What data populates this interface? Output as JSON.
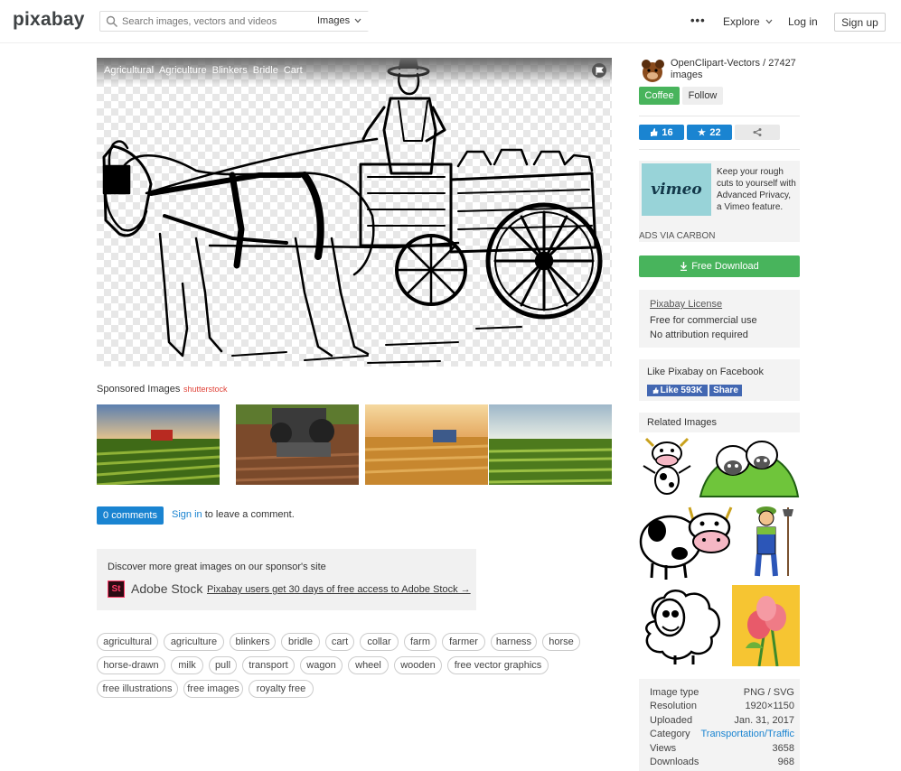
{
  "header": {
    "logo": "pixabay",
    "search_placeholder": "Search images, vectors and videos",
    "search_type": "Images",
    "more": "•••",
    "explore": "Explore",
    "login": "Log in",
    "signup": "Sign up"
  },
  "image": {
    "tags": [
      "Agricultural",
      "Agriculture",
      "Blinkers",
      "Bridle",
      "Cart"
    ]
  },
  "sponsored": {
    "label": "Sponsored Images",
    "provider": "shutterstock"
  },
  "comments": {
    "button": "0 comments",
    "signin": "Sign in",
    "rest": " to leave a comment."
  },
  "adobe": {
    "heading": "Discover more great images on our sponsor's site",
    "logo": "St",
    "brand": "Adobe Stock",
    "link": "Pixabay users get 30 days of free access to Adobe Stock →"
  },
  "tags": [
    "agricultural",
    "agriculture",
    "blinkers",
    "bridle",
    "cart",
    "collar",
    "farm",
    "farmer",
    "harness",
    "horse",
    "horse-drawn",
    "milk",
    "pull",
    "transport",
    "wagon",
    "wheel",
    "wooden",
    "free vector graphics",
    "free illustrations",
    "free images",
    "royalty free"
  ],
  "sidebar": {
    "author": "OpenClipart-Vectors / 27427 images",
    "coffee": "Coffee",
    "follow": "Follow",
    "likes": "16",
    "favorites": "22",
    "ad_text": "Keep your rough cuts to yourself with Advanced Privacy, a Vimeo feature.",
    "ad_brand": "vimeo",
    "ad_via": "ADS VIA CARBON",
    "download": "Free Download",
    "license_title": "Pixabay License",
    "license_line1": "Free for commercial use",
    "license_line2": "No attribution required",
    "fb_title": "Like Pixabay on Facebook",
    "fb_like": "Like 593K",
    "fb_share": "Share",
    "related": "Related Images"
  },
  "info": [
    {
      "key": "Image type",
      "value": "PNG / SVG"
    },
    {
      "key": "Resolution",
      "value": "1920×1150"
    },
    {
      "key": "Uploaded",
      "value": "Jan. 31, 2017"
    },
    {
      "key": "Category",
      "value": "Transportation/Traffic"
    },
    {
      "key": "Views",
      "value": "3658"
    },
    {
      "key": "Downloads",
      "value": "968"
    }
  ],
  "colors": {
    "accent_blue": "#1a84d1",
    "accent_green": "#48b45c"
  }
}
